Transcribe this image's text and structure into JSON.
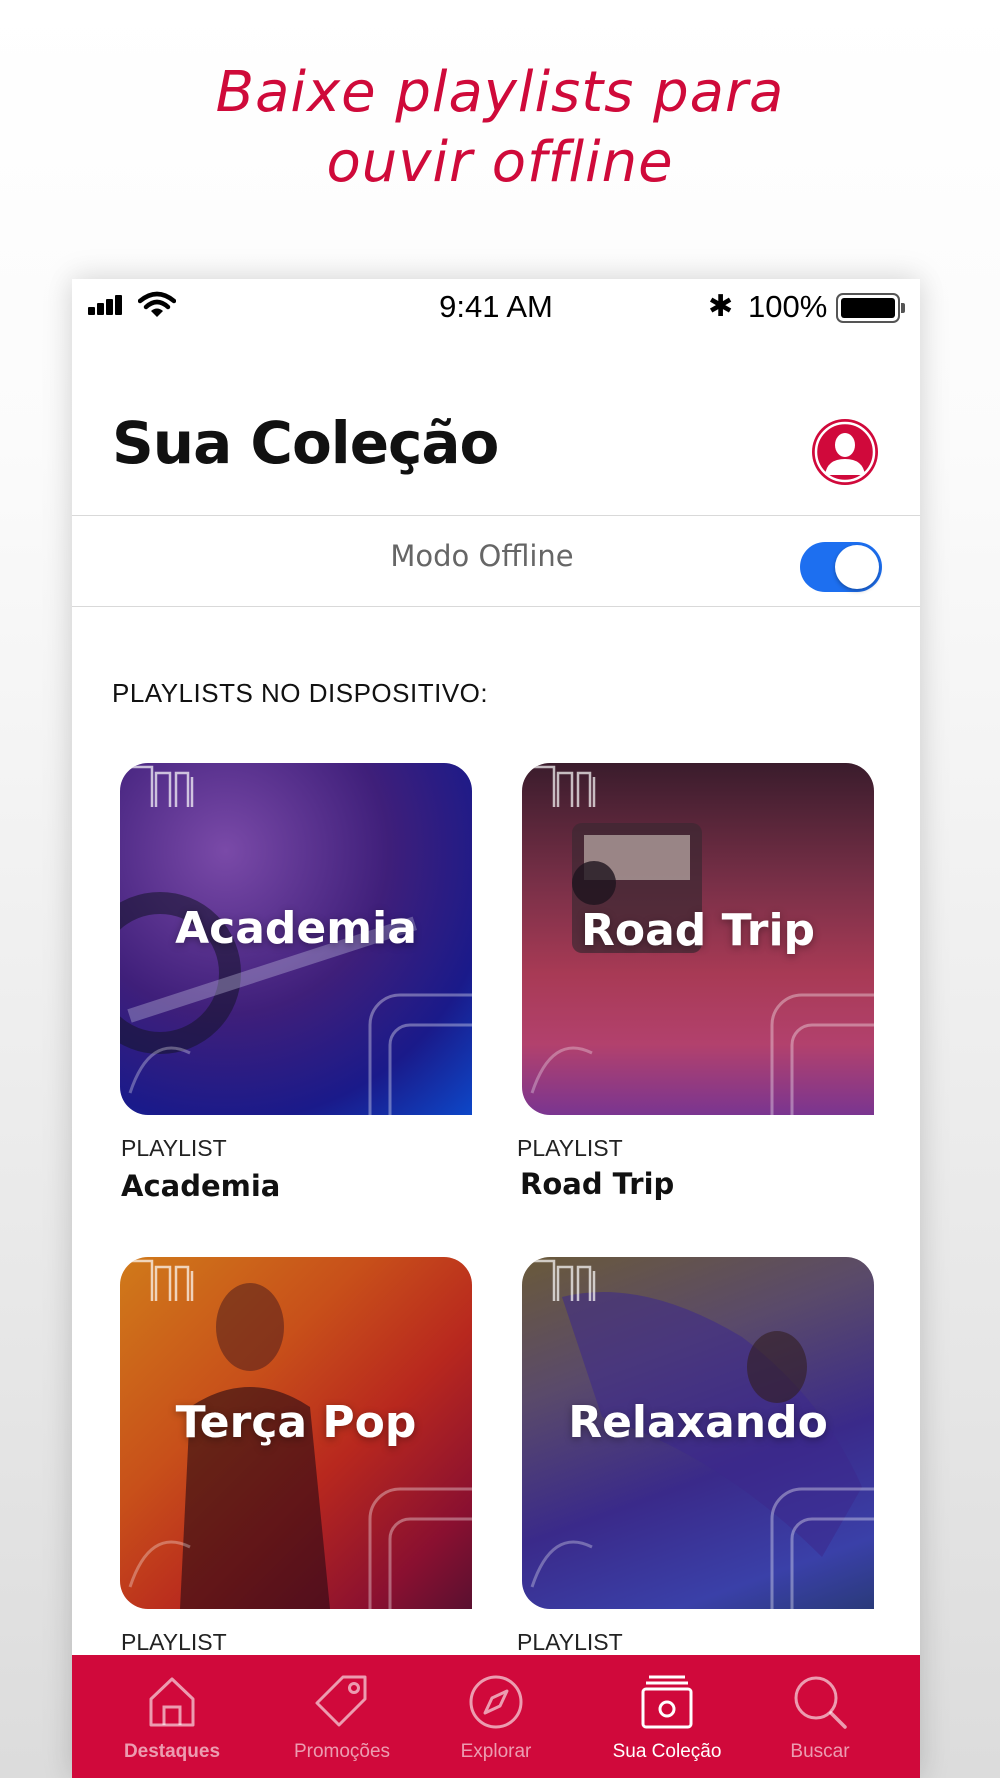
{
  "promo": {
    "line1": "Baixe playlists para",
    "line2": "ouvir offline"
  },
  "status_bar": {
    "time": "9:41 AM",
    "battery_percent": "100%",
    "icons": [
      "signal-icon",
      "wifi-icon",
      "bluetooth-icon",
      "battery-icon"
    ]
  },
  "header": {
    "title": "Sua Coleção",
    "avatar_icon": "user-icon"
  },
  "offline": {
    "label": "Modo Offline",
    "enabled": true
  },
  "section": {
    "title": "PLAYLISTS NO DISPOSITIVO:"
  },
  "playlists": [
    {
      "cover_title": "Academia",
      "type": "PLAYLIST",
      "name": "Academia"
    },
    {
      "cover_title": "Road Trip",
      "type": "PLAYLIST",
      "name": "Road Trip"
    },
    {
      "cover_title": "Terça Pop",
      "type": "PLAYLIST",
      "name": ""
    },
    {
      "cover_title": "Relaxando",
      "type": "PLAYLIST",
      "name": ""
    }
  ],
  "tabs": [
    {
      "label": "Destaques",
      "icon": "home-icon"
    },
    {
      "label": "Promoções",
      "icon": "tag-icon"
    },
    {
      "label": "Explorar",
      "icon": "compass-icon"
    },
    {
      "label": "Sua Coleção",
      "icon": "collection-icon",
      "active": true
    },
    {
      "label": "Buscar",
      "icon": "search-icon"
    }
  ],
  "colors": {
    "brand": "#d0093b",
    "toggle_on": "#1d6ff0",
    "promo_text": "#cf0a3a"
  }
}
